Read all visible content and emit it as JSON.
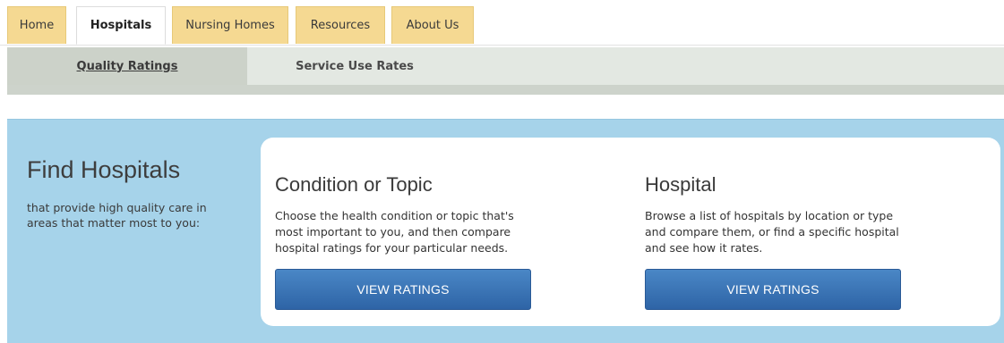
{
  "top_nav": {
    "tabs": [
      {
        "label": "Home"
      },
      {
        "label": "Hospitals",
        "active": true
      },
      {
        "label": "Nursing Homes"
      },
      {
        "label": "Resources"
      },
      {
        "label": "About Us"
      }
    ]
  },
  "sub_nav": {
    "tabs": [
      {
        "label": "Quality Ratings",
        "active": true
      },
      {
        "label": "Service Use Rates"
      }
    ]
  },
  "hero": {
    "title": "Find Hospitals",
    "subtitle": "that provide high quality care in areas that matter most to you:",
    "columns": [
      {
        "title": "Condition or Topic",
        "text": "Choose the health condition or topic that's most important to you, and then compare hospital ratings for your particular needs.",
        "button": "VIEW RATINGS"
      },
      {
        "title": "Hospital",
        "text": "Browse a list of hospitals by location or type and compare them, or find a specific hospital and see how it rates.",
        "button": "VIEW RATINGS"
      }
    ]
  },
  "colors": {
    "tab_bg": "#f5d992",
    "subnav_bg": "#e3e8e2",
    "hero_bg": "#a6d3ea",
    "button_blue": "#2e64a6"
  }
}
